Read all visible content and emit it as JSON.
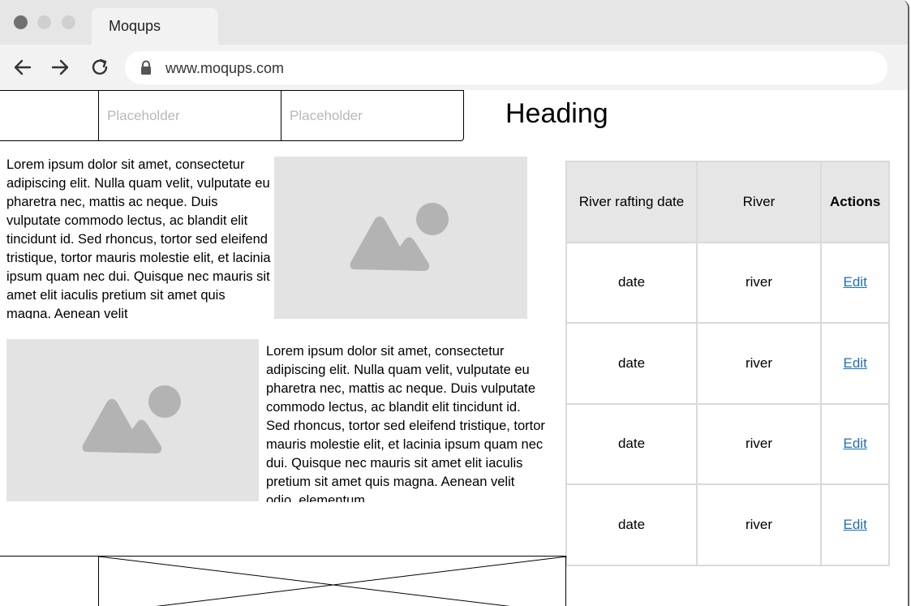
{
  "browser": {
    "tab_title": "Moqups",
    "url": "www.moqups.com"
  },
  "form": {
    "input1_placeholder": "Placeholder",
    "input2_placeholder": "Placeholder",
    "heading": "Heading"
  },
  "content": {
    "paragraph1": "Lorem ipsum dolor sit amet, consectetur adipiscing elit. Nulla quam velit, vulputate eu pharetra nec, mattis ac neque. Duis vulputate commodo lectus, ac blandit elit tincidunt id. Sed rhoncus, tortor sed eleifend tristique, tortor mauris molestie elit, et lacinia ipsum quam nec dui. Quisque nec mauris sit amet elit iaculis pretium sit amet quis magna. Aenean velit",
    "paragraph2": "Lorem ipsum dolor sit amet, consectetur adipiscing elit. Nulla quam velit, vulputate eu pharetra nec, mattis ac neque. Duis vulputate commodo lectus, ac blandit elit tincidunt id. Sed rhoncus, tortor sed eleifend tristique, tortor mauris molestie elit, et lacinia ipsum quam nec dui. Quisque nec mauris sit amet elit iaculis pretium sit amet quis magna. Aenean velit odio, elementum"
  },
  "table": {
    "headers": [
      "River rafting date",
      "River",
      "Actions"
    ],
    "rows": [
      {
        "date": "date",
        "river": "river",
        "action": "Edit"
      },
      {
        "date": "date",
        "river": "river",
        "action": "Edit"
      },
      {
        "date": "date",
        "river": "river",
        "action": "Edit"
      },
      {
        "date": "date",
        "river": "river",
        "action": "Edit"
      }
    ]
  },
  "icons": {
    "back": "arrow-left-icon",
    "forward": "arrow-right-icon",
    "reload": "reload-icon",
    "lock": "lock-icon",
    "image": "image-placeholder-icon"
  },
  "colors": {
    "link": "#1f6fb5",
    "table_header_bg": "#e6e6e6",
    "image_placeholder_bg": "#e3e3e3"
  }
}
